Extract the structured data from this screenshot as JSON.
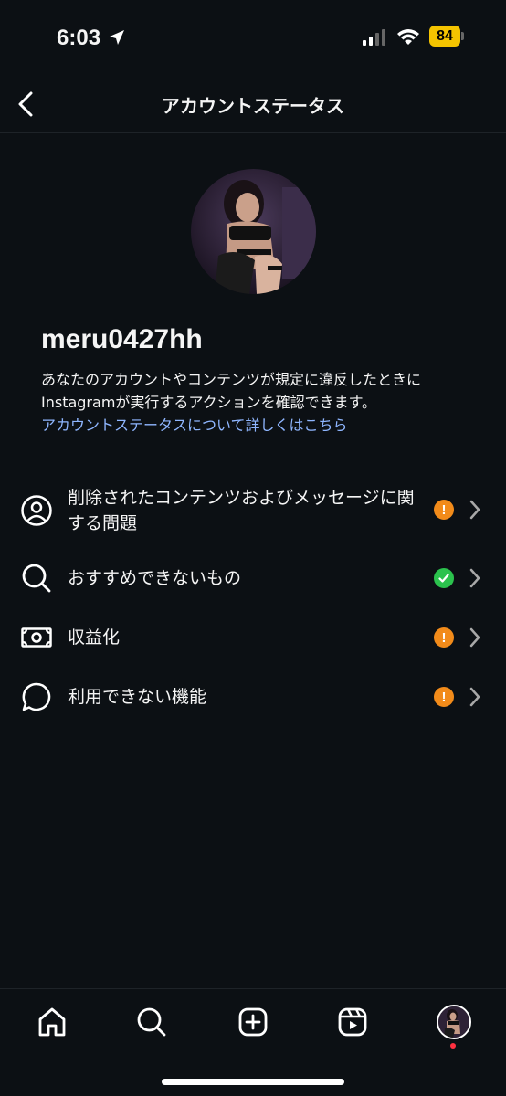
{
  "status_bar": {
    "time": "6:03",
    "battery": "84"
  },
  "header": {
    "title": "アカウントステータス"
  },
  "profile": {
    "username": "meru0427hh",
    "description": "あなたのアカウントやコンテンツが規定に違反したときにInstagramが実行するアクションを確認できます。",
    "learn_more": "アカウントステータスについて詳しくはこちら"
  },
  "rows": [
    {
      "label": "削除されたコンテンツおよびメッセージに関する問題",
      "icon": "person-circle-icon",
      "status": "warning",
      "status_color": "#f28b1a"
    },
    {
      "label": "おすすめできないもの",
      "icon": "search-icon",
      "status": "ok",
      "status_color": "#2bc24d"
    },
    {
      "label": "収益化",
      "icon": "money-icon",
      "status": "warning",
      "status_color": "#f28b1a"
    },
    {
      "label": "利用できない機能",
      "icon": "chat-bubble-icon",
      "status": "warning",
      "status_color": "#f28b1a"
    }
  ],
  "status_symbols": {
    "warning": "!"
  },
  "tab_bar": {
    "items": [
      "home-icon",
      "search-icon",
      "create-icon",
      "reels-icon",
      "profile-avatar"
    ]
  }
}
